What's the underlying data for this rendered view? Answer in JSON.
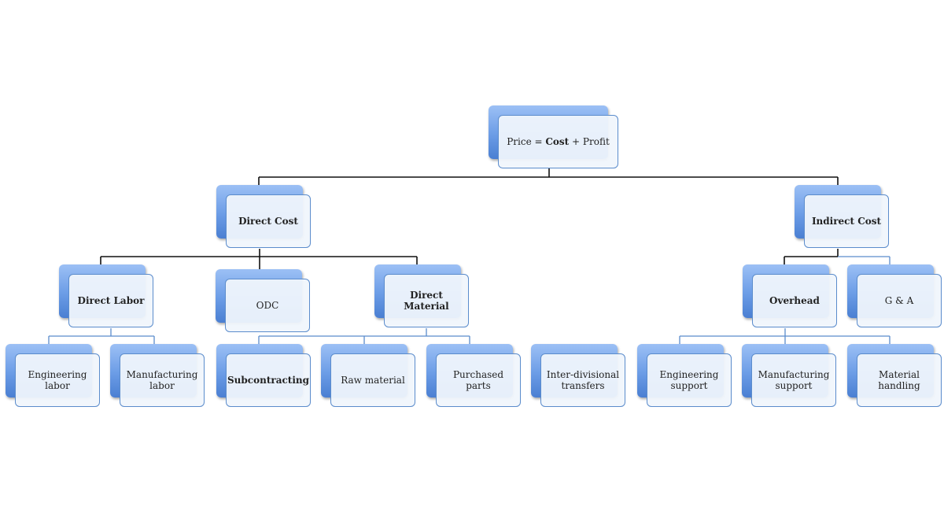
{
  "root": {
    "prefix": "Price = ",
    "bold": "Cost",
    "suffix": " + Profit"
  },
  "nodes": [
    {
      "id": "direct-cost",
      "label": "Direct Cost",
      "bold": true
    },
    {
      "id": "indirect-cost",
      "label": "Indirect Cost",
      "bold": true
    },
    {
      "id": "direct-labor",
      "label": "Direct Labor",
      "bold": true
    },
    {
      "id": "odc",
      "label": "ODC",
      "bold": false
    },
    {
      "id": "direct-material",
      "label": "Direct Material",
      "bold": true
    },
    {
      "id": "overhead",
      "label": "Overhead",
      "bold": true
    },
    {
      "id": "g-and-a",
      "label": "G & A",
      "bold": false
    },
    {
      "id": "engineering-labor",
      "label": "Engineering labor",
      "bold": false
    },
    {
      "id": "manufacturing-labor",
      "label": "Manufacturing labor",
      "bold": false
    },
    {
      "id": "subcontracting",
      "label": "Subcontracting",
      "bold": true
    },
    {
      "id": "raw-material",
      "label": "Raw material",
      "bold": false
    },
    {
      "id": "purchased-parts",
      "label": "Purchased parts",
      "bold": false
    },
    {
      "id": "inter-divisional-transfers",
      "label": "Inter-divisional transfers",
      "bold": false
    },
    {
      "id": "engineering-support",
      "label": "Engineering support",
      "bold": false
    },
    {
      "id": "manufacturing-support",
      "label": "Manufacturing support",
      "bold": false
    },
    {
      "id": "material-handling",
      "label": "Material handling",
      "bold": false
    }
  ],
  "colors": {
    "box_border": "#5b8ccc",
    "box_back": "#6b9ce6",
    "line_dark": "#111111",
    "line_blue": "#5b8ccc"
  }
}
